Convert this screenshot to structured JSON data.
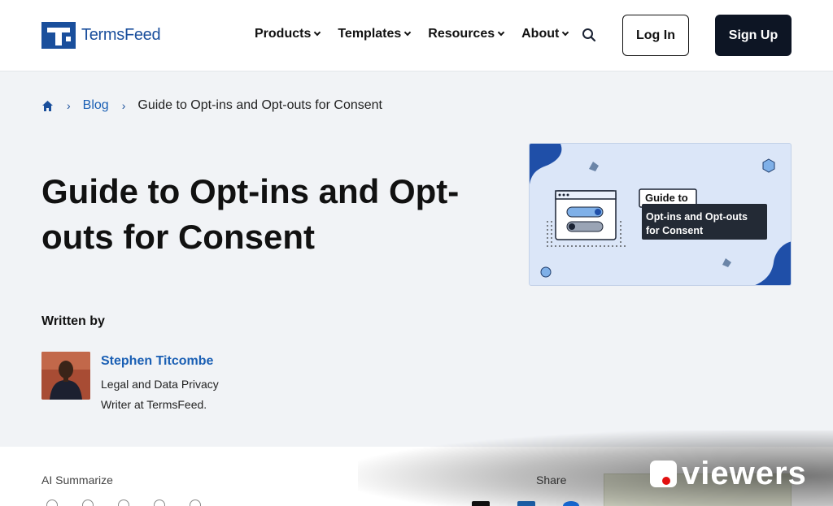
{
  "header": {
    "logo_text": "TermsFeed",
    "nav": [
      "Products",
      "Templates",
      "Resources",
      "About"
    ],
    "login_label": "Log In",
    "signup_label": "Sign Up"
  },
  "breadcrumb": {
    "home_icon": "home-icon",
    "items": [
      "Blog",
      "Guide to Opt-ins and Opt-outs for Consent"
    ]
  },
  "article": {
    "title": "Guide to Opt-ins and Opt-outs for Consent",
    "hero": {
      "badge": "Guide to",
      "caption_line1": "Opt-ins and Opt-outs",
      "caption_line2": "for Consent"
    }
  },
  "author": {
    "written_by": "Written by",
    "name": "Stephen Titcombe",
    "bio": "Legal and Data Privacy Writer at TermsFeed."
  },
  "bottom": {
    "ai_summarize": "AI Summarize",
    "share": "Share"
  },
  "watermark": {
    "text": "viewers"
  },
  "colors": {
    "brand_blue": "#1a4f9c",
    "link_blue": "#1a5fb4",
    "dark": "#0d1524",
    "background": "#f1f3f6"
  }
}
